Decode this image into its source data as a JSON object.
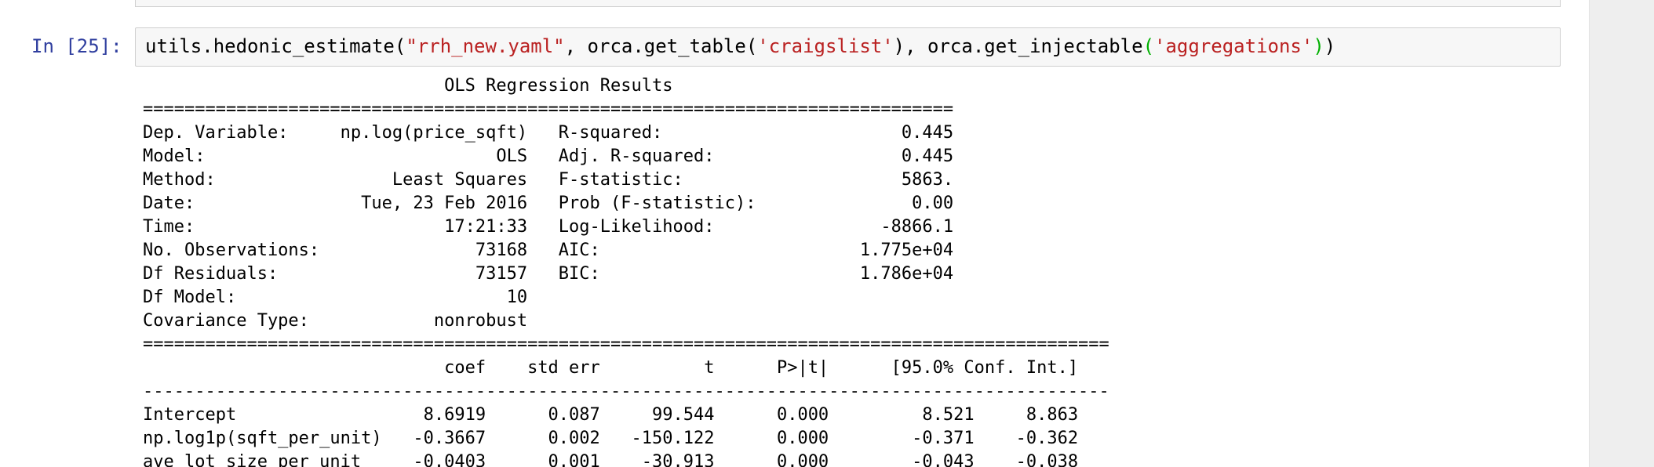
{
  "cell": {
    "prompt": "In [25]:",
    "code_segments": [
      {
        "text": "utils.hedonic_estimate(",
        "kind": "plain"
      },
      {
        "text": "\"rrh_new.yaml\"",
        "kind": "str"
      },
      {
        "text": ", orca.get_table(",
        "kind": "plain"
      },
      {
        "text": "'craigslist'",
        "kind": "str"
      },
      {
        "text": "), orca.get_injectable",
        "kind": "plain"
      },
      {
        "text": "(",
        "kind": "paren-match"
      },
      {
        "text": "'aggregations'",
        "kind": "str"
      },
      {
        "text": ")",
        "kind": "paren-match"
      },
      {
        "text": ")",
        "kind": "plain"
      }
    ]
  },
  "output": {
    "lines": [
      "                             OLS Regression Results                            ",
      "==============================================================================",
      "Dep. Variable:     np.log(price_sqft)   R-squared:                       0.445",
      "Model:                            OLS   Adj. R-squared:                  0.445",
      "Method:                 Least Squares   F-statistic:                     5863.",
      "Date:                Tue, 23 Feb 2016   Prob (F-statistic):               0.00",
      "Time:                        17:21:33   Log-Likelihood:                -8866.1",
      "No. Observations:               73168   AIC:                         1.775e+04",
      "Df Residuals:                   73157   BIC:                         1.786e+04",
      "Df Model:                          10                                         ",
      "Covariance Type:            nonrobust                                         ",
      "=============================================================================================",
      "                             coef    std err          t      P>|t|      [95.0% Conf. Int.]",
      "---------------------------------------------------------------------------------------------",
      "Intercept                  8.6919      0.087     99.544      0.000         8.521     8.863",
      "np.log1p(sqft_per_unit)   -0.3667      0.002   -150.122      0.000        -0.371    -0.362",
      "ave_lot_size_per_unit     -0.0403      0.001    -30.913      0.000        -0.043    -0.038"
    ]
  }
}
